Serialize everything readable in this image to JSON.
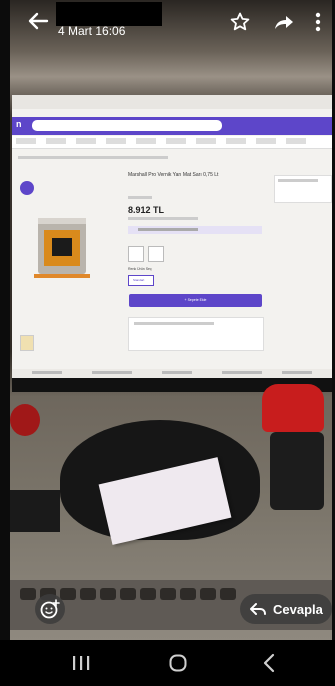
{
  "header": {
    "date_time": "4 Mart 16:06",
    "icons": [
      "back-arrow-icon",
      "star-icon",
      "share-icon",
      "more-vertical-icon"
    ]
  },
  "reply": {
    "label": "Cevapla"
  },
  "screen": {
    "product_title": "Marshall Pro Vernik Yarı Mat Sarı 0,75 Lt",
    "price": "8.912 TL",
    "add_to_cart": "+ Sepete Ekle",
    "color_selector_label": "Renk Ürün Seç",
    "selected_option": "Standart"
  },
  "navbar": {
    "icons": [
      "recent-apps-icon",
      "home-icon",
      "back-icon"
    ]
  },
  "colors": {
    "brand_purple": "#5d46c9",
    "overlay_bg": "#3c3c3c",
    "nav_bg": "#000000"
  }
}
